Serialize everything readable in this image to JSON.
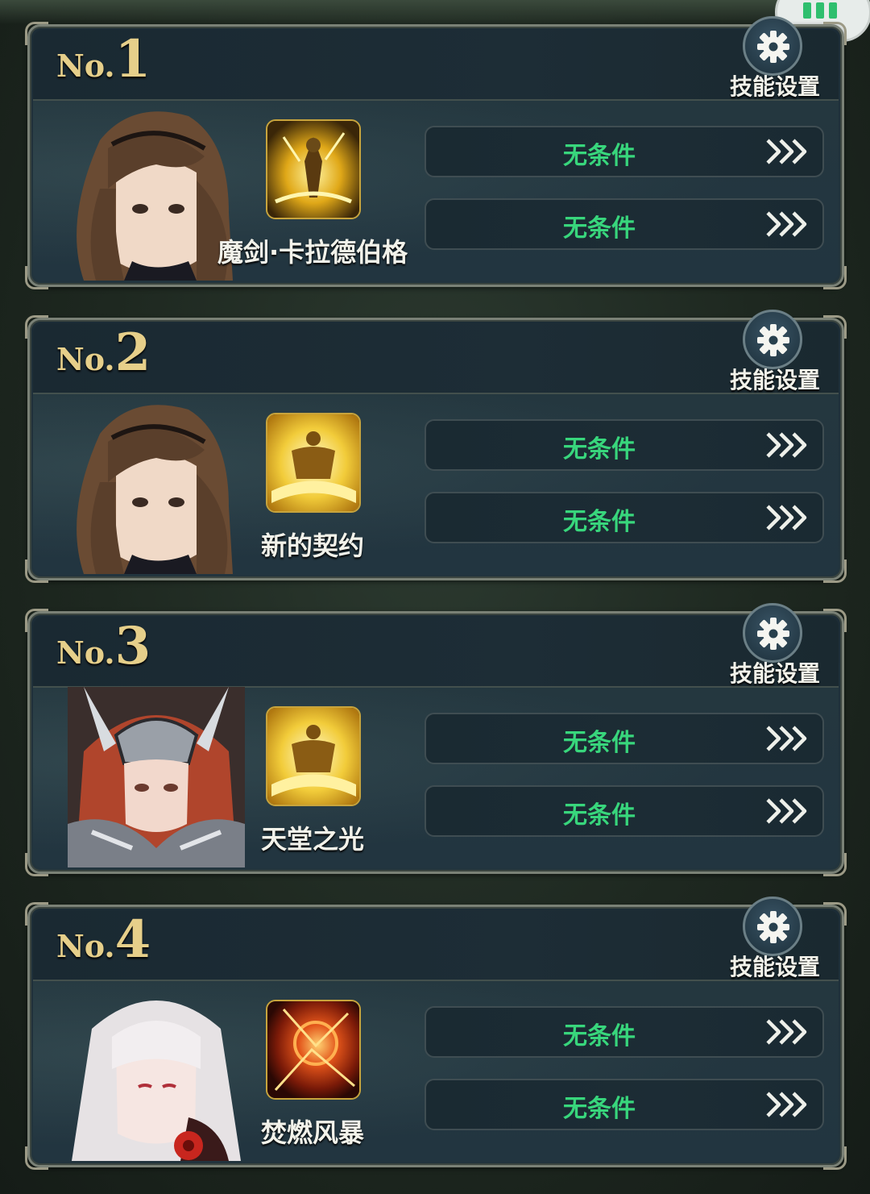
{
  "setting_label": "技能设置",
  "rank_prefix": "No.",
  "cards": [
    {
      "number": "1",
      "skill_name": "魔剑·卡拉德伯格",
      "skill_icon": "golden-knight-burst-icon",
      "portrait": "brown-hair-girl",
      "conditions": [
        "无条件",
        "无条件"
      ]
    },
    {
      "number": "2",
      "skill_name": "新的契约",
      "skill_icon": "golden-warrior-icon",
      "portrait": "brown-hair-girl",
      "conditions": [
        "无条件",
        "无条件"
      ]
    },
    {
      "number": "3",
      "skill_name": "天堂之光",
      "skill_icon": "golden-warrior-icon",
      "portrait": "red-hair-armored-knight",
      "conditions": [
        "无条件",
        "无条件"
      ]
    },
    {
      "number": "4",
      "skill_name": "焚燃风暴",
      "skill_icon": "fire-storm-icon",
      "portrait": "white-hair-girl",
      "conditions": [
        "无条件",
        "无条件"
      ]
    }
  ],
  "colors": {
    "condition_text": "#38d67c",
    "rank_gold": "#e6cf8a",
    "frame": "#7a8176"
  }
}
